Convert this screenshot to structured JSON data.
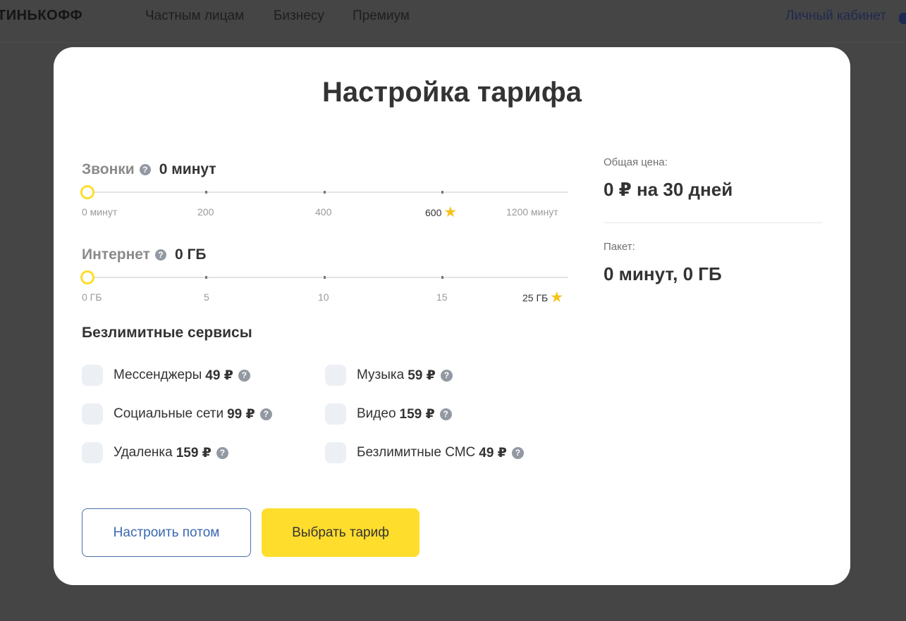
{
  "nav": {
    "logo": "ТИНЬКОФФ",
    "links": [
      "Частным лицам",
      "Бизнесу",
      "Премиум"
    ],
    "cabinet": "Личный кабинет"
  },
  "modal": {
    "title": "Настройка тарифа",
    "calls": {
      "label": "Звонки",
      "value": "0 минут",
      "level": 0,
      "scale": [
        "0 минут",
        "200",
        "400",
        "600",
        "1200 минут"
      ]
    },
    "internet": {
      "label": "Интернет",
      "value": "0 ГБ",
      "level": 0,
      "scale": [
        "0 ГБ",
        "5",
        "10",
        "15",
        "25 ГБ"
      ]
    },
    "services": {
      "title": "Безлимитные сервисы",
      "items": [
        {
          "name": "Мессенджеры",
          "price": "49 ₽"
        },
        {
          "name": "Социальные сети",
          "price": "99 ₽"
        },
        {
          "name": "Удаленка",
          "price": "159 ₽"
        },
        {
          "name": "Музыка",
          "price": "59 ₽"
        },
        {
          "name": "Видео",
          "price": "159 ₽"
        },
        {
          "name": "Безлимитные СМС",
          "price": "49 ₽"
        }
      ]
    },
    "buttons": {
      "later": "Настроить потом",
      "choose": "Выбрать тариф"
    },
    "summary": {
      "price_label": "Общая цена:",
      "price_value": "0 ₽ на 30 дней",
      "package_label": "Пакет:",
      "package_value": "0 минут, 0 ГБ"
    }
  },
  "icons": {
    "help": "question-circle-icon",
    "star": "star-icon"
  },
  "colors": {
    "accent": "#ffdd2d",
    "link": "#3a68b0",
    "star": "#f7c21c",
    "overlay": "#454545"
  }
}
